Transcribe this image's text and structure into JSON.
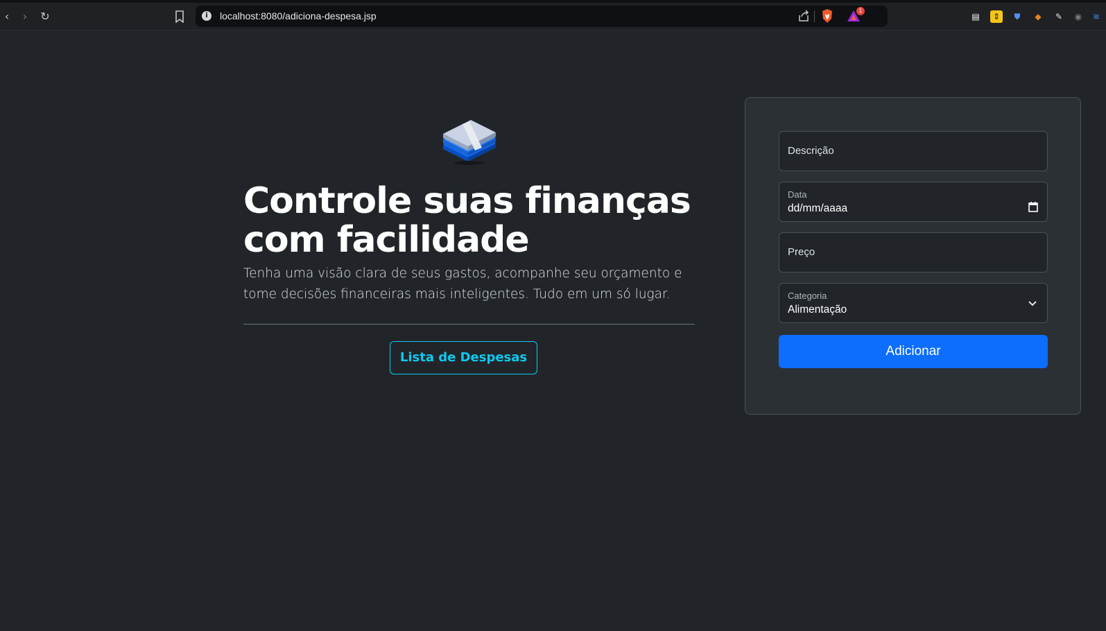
{
  "browser": {
    "url": "localhost:8080/adiciona-despesa.jsp",
    "rewards_badge": "1",
    "info_glyph": "i",
    "nav": {
      "back_glyph": "‹",
      "forward_glyph": "›",
      "reload_glyph": "↻"
    },
    "extensions": [
      {
        "name": "printer-extension-icon",
        "glyph": "▤",
        "color": "#d0d0d0"
      },
      {
        "name": "arrows-extension-icon",
        "glyph": "⇕",
        "color": "#f5c518"
      },
      {
        "name": "bitwarden-extension-icon",
        "glyph": "⛊",
        "color": "#5b8def"
      },
      {
        "name": "metamask-extension-icon",
        "glyph": "◆",
        "color": "#e8821e"
      },
      {
        "name": "eyedropper-extension-icon",
        "glyph": "✎",
        "color": "#e0e0e0"
      },
      {
        "name": "radio-extension-icon",
        "glyph": "◉",
        "color": "#7a7a7a"
      },
      {
        "name": "wave-extension-icon",
        "glyph": "≋",
        "color": "#4a90e2"
      }
    ]
  },
  "hero": {
    "title": "Controle suas finanças com facilidade",
    "subtitle": "Tenha uma visão clara de seus gastos, acompanhe seu orçamento e tome decisões financeiras mais inteligentes. Tudo em um só lugar.",
    "list_button": "Lista de Despesas"
  },
  "form": {
    "descricao_placeholder": "Descrição",
    "data_label": "Data",
    "data_value": "dd/mm/aaaa",
    "preco_placeholder": "Preço",
    "categoria_label": "Categoria",
    "categoria_value": "Alimentação",
    "submit_button": "Adicionar"
  },
  "colors": {
    "background": "#212529",
    "card": "#2b3035",
    "primary": "#0d6efd",
    "info": "#0dcaf0"
  }
}
